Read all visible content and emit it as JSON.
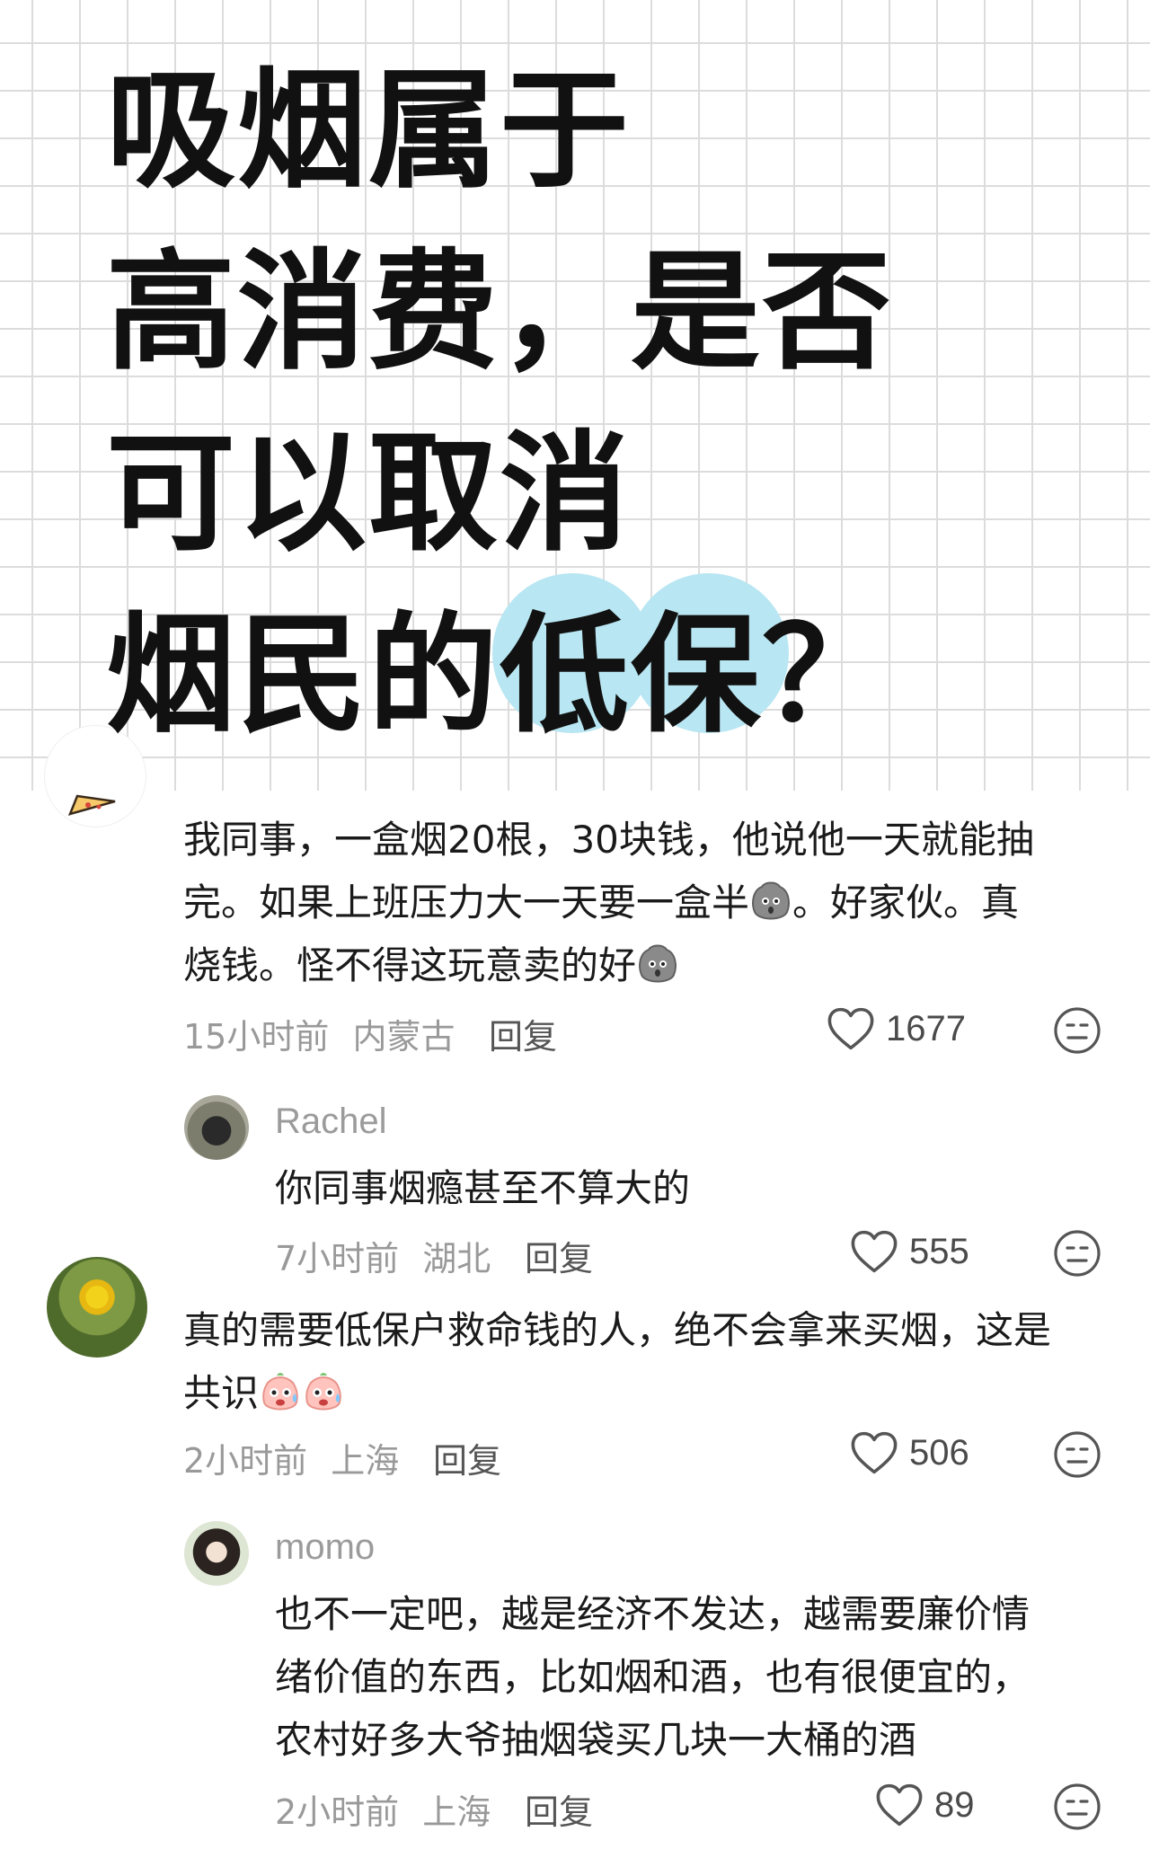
{
  "headline": {
    "lines": [
      "吸烟属于",
      "高消费，是否",
      "可以取消",
      "烟民的低保？"
    ],
    "highlight_color": "#b8e6f2"
  },
  "icons": {
    "like": "heart-outline-icon",
    "dislike": "meh-face-icon",
    "emoji_shocked": "shocked-potato-emoji",
    "emoji_sweat": "sweating-face-emoji"
  },
  "comments": [
    {
      "name": "",
      "lines": [
        "我同事，一盒烟20根，30块钱，他说他一天就能抽",
        "完。如果上班压力大一天要一盒半",
        "。好家伙。真",
        "烧钱。怪不得这玩意卖的好"
      ],
      "time": "15小时前",
      "location": "内蒙古",
      "reply_label": "回复",
      "likes": "1677"
    },
    {
      "name": "Rachel",
      "lines": [
        "你同事烟瘾甚至不算大的"
      ],
      "time": "7小时前",
      "location": "湖北",
      "reply_label": "回复",
      "likes": "555"
    },
    {
      "name": "",
      "lines": [
        "真的需要低保户救命钱的人，绝不会拿来买烟，这是",
        "共识"
      ],
      "time": "2小时前",
      "location": "上海",
      "reply_label": "回复",
      "likes": "506"
    },
    {
      "name": "momo",
      "lines": [
        "也不一定吧，越是经济不发达，越需要廉价情",
        "绪价值的东西，比如烟和酒，也有很便宜的，",
        "农村好多大爷抽烟袋买几块一大桶的酒"
      ],
      "time": "2小时前",
      "location": "上海",
      "reply_label": "回复",
      "likes": "89"
    }
  ]
}
